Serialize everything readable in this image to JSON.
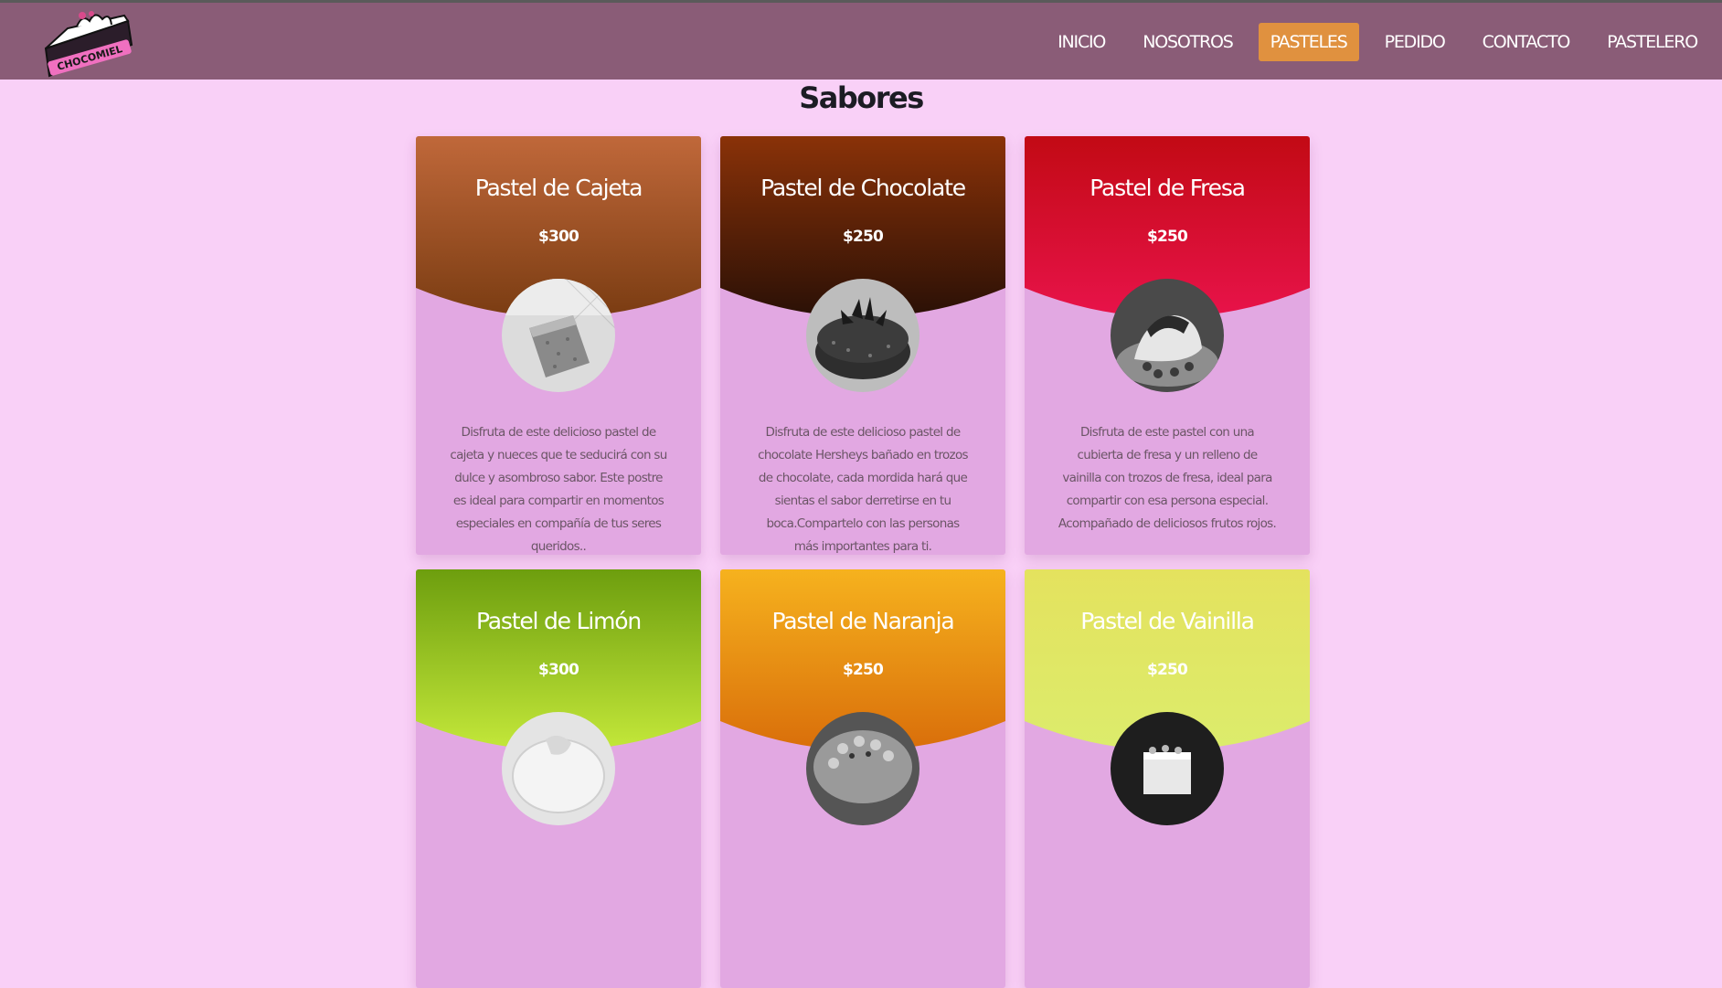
{
  "brand": {
    "logo_text": "CHOCOMIEL"
  },
  "nav": {
    "items": [
      {
        "label": "INICIO"
      },
      {
        "label": "NOSOTROS"
      },
      {
        "label": "PASTELES"
      },
      {
        "label": "PEDIDO"
      },
      {
        "label": "CONTACTO"
      },
      {
        "label": "PASTELERO"
      }
    ],
    "active": "PASTELES"
  },
  "section": {
    "title": "Sabores"
  },
  "cards": [
    {
      "name": "Pastel de Cajeta",
      "price": "$300",
      "description": "Disfruta de este delicioso pastel de cajeta y nueces que te seducirá con su dulce y asombroso sabor. Este postre es ideal para compartir en momentos especiales en compañía de tus seres queridos..",
      "color_top": "#c0683a",
      "color_bottom": "#7a3c12",
      "photo": "cake-slice-photo"
    },
    {
      "name": "Pastel de Chocolate",
      "price": "$250",
      "description": "Disfruta de este delicioso pastel de chocolate Hersheys bañado en trozos de chocolate, cada mordida hará que sientas el sabor derretirse en tu boca.Compartelo con las personas más importantes para ti.",
      "color_top": "#8a3208",
      "color_bottom": "#2a1006",
      "photo": "chocolate-cake-photo"
    },
    {
      "name": "Pastel de Fresa",
      "price": "$250",
      "description": "Disfruta de este pastel con una cubierta de fresa y un relleno de vainilla con trozos de fresa, ideal para compartir con esa persona especial. Acompañado de deliciosos frutos rojos.",
      "color_top": "#c20a14",
      "color_bottom": "#e8134a",
      "photo": "strawberry-cake-photo"
    },
    {
      "name": "Pastel de Limón",
      "price": "$300",
      "description": "",
      "color_top": "#6d9e0e",
      "color_bottom": "#c4e83a",
      "photo": "lemon-cake-photo"
    },
    {
      "name": "Pastel de Naranja",
      "price": "$250",
      "description": "",
      "color_top": "#f6b21e",
      "color_bottom": "#d96e0a",
      "photo": "orange-cake-photo"
    },
    {
      "name": "Pastel de Vainilla",
      "price": "$250",
      "description": "",
      "color_top": "#e4e25e",
      "color_bottom": "#dcec6c",
      "photo": "vanilla-cake-photo"
    }
  ]
}
